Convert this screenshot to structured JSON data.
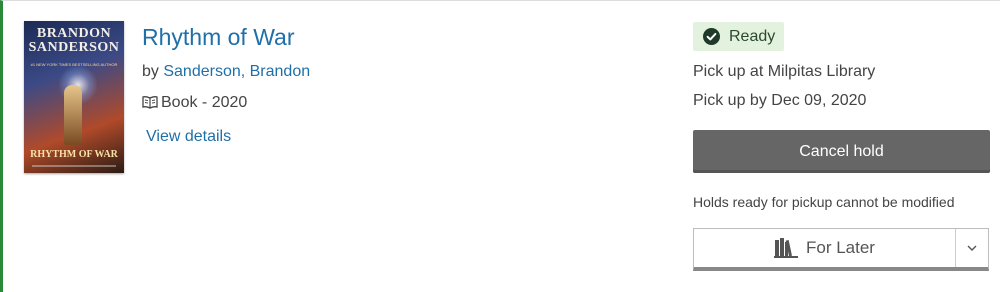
{
  "book": {
    "title": "Rhythm of War",
    "cover": {
      "author_text": "BRANDON SANDERSON",
      "tagline": "#1 NEW YORK TIMES BESTSELLING AUTHOR",
      "title_text": "RHYTHM OF WAR"
    },
    "by_prefix": "by ",
    "author": "Sanderson, Brandon",
    "format_icon": "book-icon",
    "format": "Book - 2020",
    "view_details_label": "View details"
  },
  "hold": {
    "status_icon": "check-circle-icon",
    "status": "Ready",
    "status_color": "#2a8a3a",
    "pickup_location": "Pick up at Milpitas Library",
    "pickup_by": "Pick up by Dec 09, 2020",
    "cancel_label": "Cancel hold",
    "note": "Holds ready for pickup cannot be modified"
  },
  "shelf": {
    "icon": "shelf-books-icon",
    "label": "For Later",
    "dropdown_icon": "chevron-down-icon"
  },
  "colors": {
    "link": "#1f6fa8",
    "accent_border": "#2a8a3a",
    "ready_bg": "#e3f2df",
    "cancel_button": "#666666"
  }
}
